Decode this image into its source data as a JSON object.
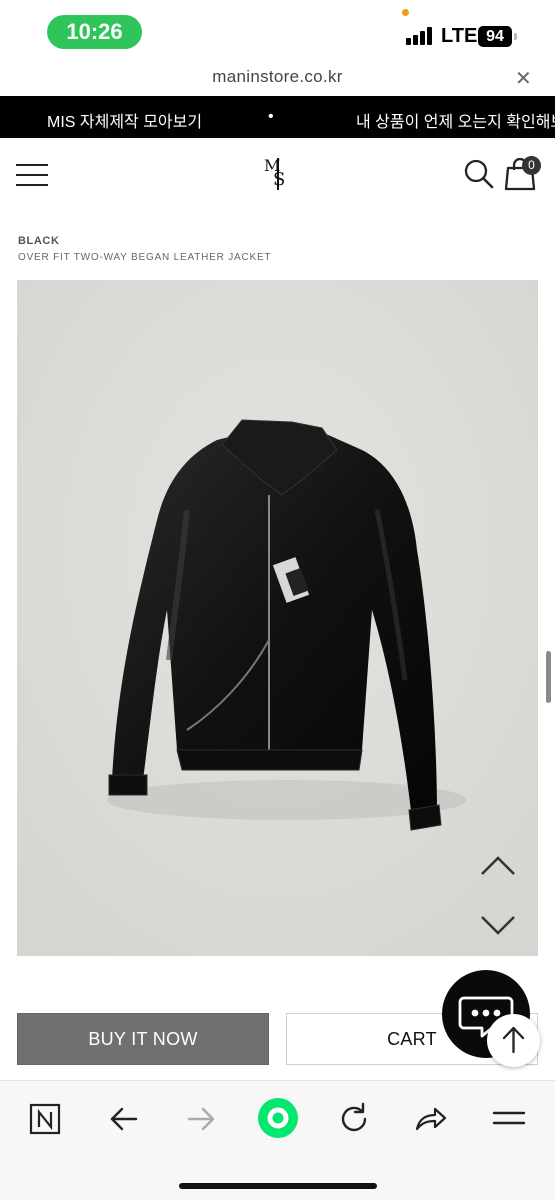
{
  "status_bar": {
    "time": "10:26",
    "network": "LTE",
    "battery": "94"
  },
  "browser": {
    "url": "maninstore.co.kr",
    "close_icon": "close-icon"
  },
  "marquee": {
    "text_1": "MIS 자체제작 모아보기",
    "separator": "•",
    "text_2": "내 상품이 언제 오는지 확인해보"
  },
  "header": {
    "logo_letters": [
      "M",
      "S"
    ],
    "cart_count": "0"
  },
  "product": {
    "color": "BLACK",
    "name": "OVER FIT TWO-WAY BEGAN LEATHER JACKET"
  },
  "actions": {
    "buy_now": "BUY IT NOW",
    "cart": "CART"
  },
  "bottom_toolbar": {
    "icons": [
      "naver-n-icon",
      "back-arrow-icon",
      "forward-arrow-icon",
      "green-dot-icon",
      "refresh-icon",
      "share-icon",
      "menu-icon"
    ]
  },
  "colors": {
    "status_green": "#2fc55a",
    "marquee_bg": "#000000",
    "buy_button": "#707070",
    "image_bg": "#dddcd8",
    "toolbar_accent": "#03e670"
  }
}
